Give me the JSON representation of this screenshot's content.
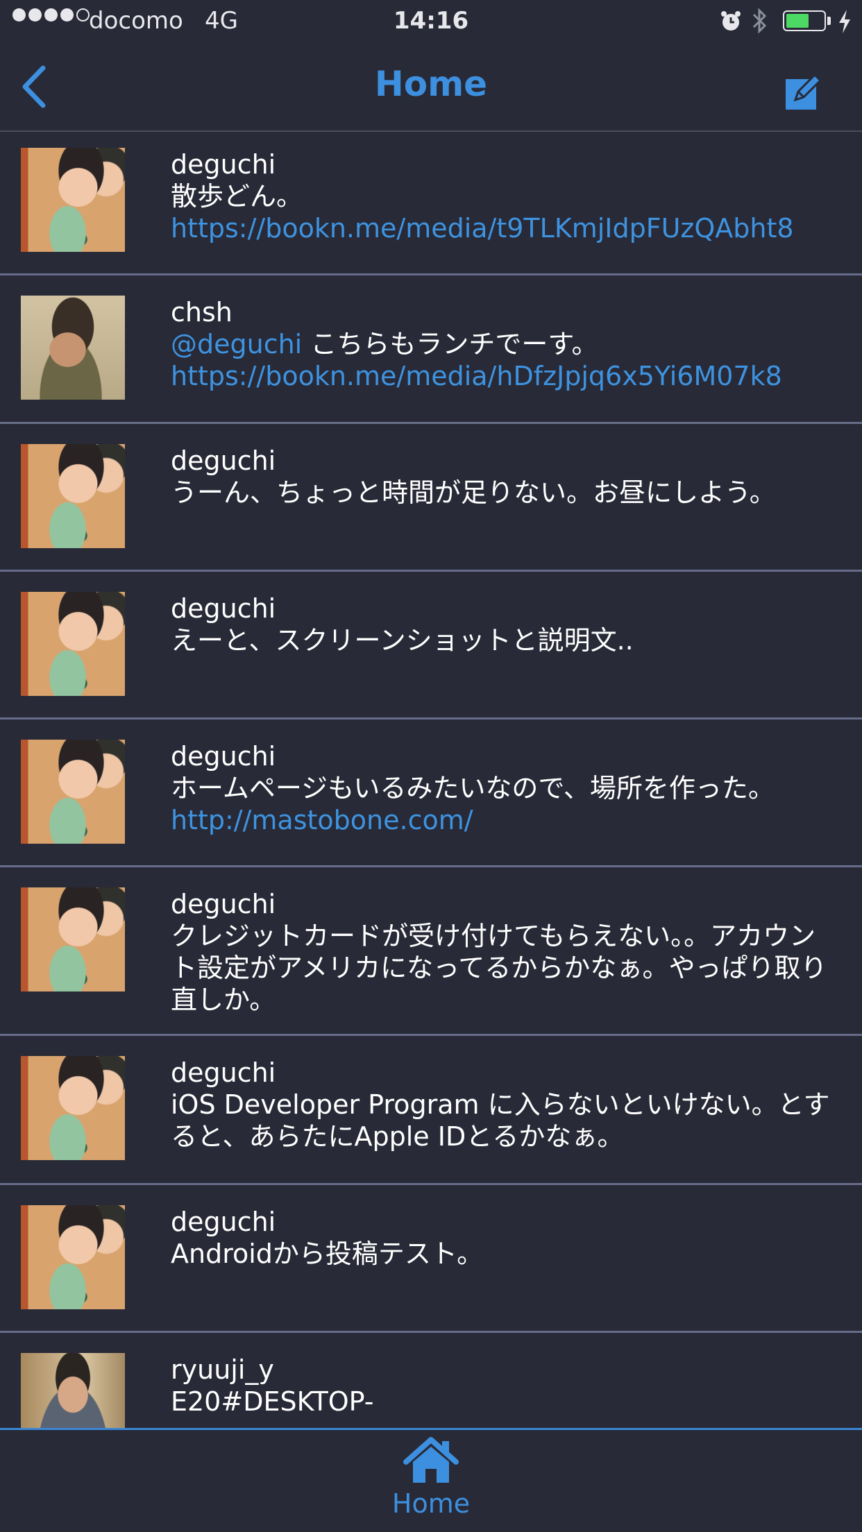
{
  "status": {
    "carrier": "docomo",
    "network": "4G",
    "time": "14:16",
    "signal_bars": 4,
    "battery_level": 0.62,
    "icons": [
      "alarm-icon",
      "bluetooth-icon",
      "battery-icon",
      "charging-icon"
    ]
  },
  "nav": {
    "title": "Home",
    "back_icon": "chevron-left-icon",
    "compose_icon": "compose-icon"
  },
  "posts": [
    {
      "user": "deguchi",
      "text": "散歩どん。",
      "link": "https://bookn.me/media/t9TLKmjIdpFUzQAbht8"
    },
    {
      "user": "chsh",
      "mention": "@deguchi",
      "text": " こちらもランチでーす。",
      "link": "https://bookn.me/media/hDfzJpjq6x5Yi6M07k8"
    },
    {
      "user": "deguchi",
      "text": "うーん、ちょっと時間が足りない。お昼にしよう。"
    },
    {
      "user": "deguchi",
      "text": "えーと、スクリーンショットと説明文.."
    },
    {
      "user": "deguchi",
      "text": "ホームページもいるみたいなので、場所を作った。",
      "link": "http://mastobone.com/"
    },
    {
      "user": "deguchi",
      "text": "クレジットカードが受け付けてもらえない。。アカウント設定がアメリカになってるからかなぁ。やっぱり取り直しか。"
    },
    {
      "user": "deguchi",
      "text": "iOS Developer Program に入らないといけない。とすると、あらたにApple IDとるかなぁ。"
    },
    {
      "user": "deguchi",
      "text": "Androidから投稿テスト。"
    },
    {
      "user": "ryuuji_y",
      "text": "E20#DESKTOP-"
    }
  ],
  "tab_bar": {
    "home_label": "Home",
    "home_icon": "house-icon"
  },
  "colors": {
    "background": "#282a37",
    "accent": "#3d8fdf",
    "link": "#3e93e0",
    "divider": "#676c8a"
  }
}
